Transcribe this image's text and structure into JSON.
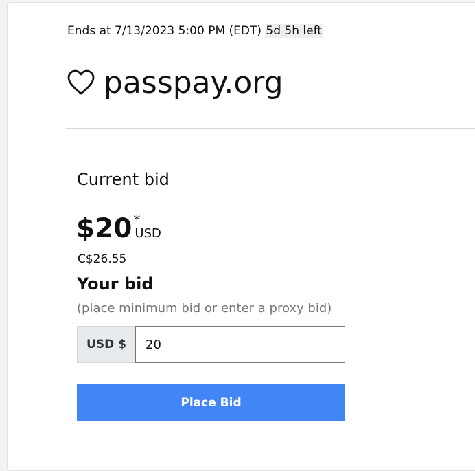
{
  "auction": {
    "ends_text": "Ends at 7/13/2023 5:00 PM (EDT)",
    "time_left": "5d 5h left"
  },
  "listing": {
    "domain_name": "passpay.org",
    "watch_icon": "heart-outline-icon"
  },
  "current_bid": {
    "label": "Current bid",
    "amount": "$20",
    "footnote_marker": "*",
    "currency": "USD",
    "converted": "C$26.55"
  },
  "your_bid": {
    "label": "Your bid",
    "hint": "(place minimum bid or enter a proxy bid)",
    "prefix": "USD $",
    "value": "20"
  },
  "actions": {
    "place_bid_label": "Place Bid"
  },
  "colors": {
    "primary_button": "#4285f4",
    "prefix_background": "#e8ebee",
    "hint_text": "#767676"
  }
}
